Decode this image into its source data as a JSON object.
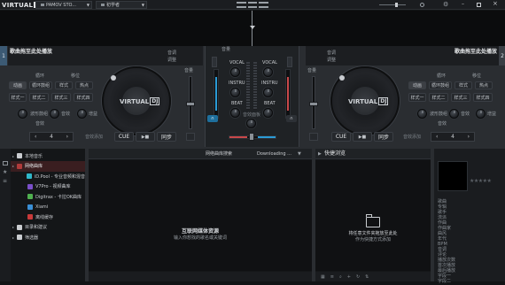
{
  "topbar": {
    "logo": "VIRTUAL",
    "logo_box": "DJ",
    "tab1": "PAMOV STO...",
    "tab2": "初学者"
  },
  "deck_left": {
    "title": "歌曲拖至此处播放",
    "sub1": "音调",
    "sub2": "调整",
    "section1": "循环",
    "section2": "移位",
    "pads_mode": "音效",
    "pad_tabs": [
      "动画",
      "循环鼓组",
      "样式",
      "热点"
    ],
    "pads": [
      "样式一",
      "样式二",
      "样式三",
      "样式四"
    ],
    "knob_labels": [
      "波形鼓组",
      "音效",
      "增益"
    ],
    "pitch_value": "4",
    "sync_label": "音效添加",
    "cue": "CUE",
    "play": "▶■",
    "sync": "同步",
    "turntable_logo": "VIRTUAL",
    "turntable_logo_box": "DJ"
  },
  "deck_right": {
    "title": "歌曲拖至此处播放",
    "sub1": "音调",
    "sub2": "调整",
    "section1": "循环",
    "section2": "移位",
    "pads_mode": "音效",
    "pad_tabs": [
      "动画",
      "循环鼓组",
      "样式",
      "热点"
    ],
    "pads": [
      "样式一",
      "样式二",
      "样式三",
      "样式四"
    ],
    "knob_labels": [
      "波形鼓组",
      "音效",
      "增益"
    ],
    "pitch_value": "4",
    "sync_label": "音效添加",
    "cue": "CUE",
    "play": "▶■",
    "sync": "同步",
    "turntable_logo": "VIRTUAL",
    "turntable_logo_box": "DJ"
  },
  "mixer": {
    "title": "音量",
    "vol_left": "音量",
    "vol_right": "音量",
    "rows": [
      "VOCAL",
      "VOCAL",
      "INSTRU",
      "INSTRU",
      "BEAT",
      "BEAT"
    ],
    "center_label": "音效面板"
  },
  "browser": {
    "tree": [
      {
        "label": "本地音乐",
        "indent": 0,
        "icon": "computer-icon"
      },
      {
        "label": "网络曲库",
        "indent": 0,
        "icon": "globe-icon",
        "selected": true
      },
      {
        "label": "iD.Pool - 专业音频和混音",
        "indent": 1,
        "icon": "idpool-icon"
      },
      {
        "label": "V7Pro - 视频曲库",
        "indent": 1,
        "icon": "video-icon"
      },
      {
        "label": "Digitrax - 卡拉OK曲库",
        "indent": 1,
        "icon": "karaoke-icon"
      },
      {
        "label": "Xiami",
        "indent": 1,
        "icon": "xiami-icon"
      },
      {
        "label": "离线缓存",
        "indent": 1,
        "icon": "cache-icon"
      },
      {
        "label": "目录和建议",
        "indent": 0,
        "icon": "list-icon"
      },
      {
        "label": "筛选器",
        "indent": 0,
        "icon": "filter-icon"
      }
    ],
    "search_label": "网络曲库搜索",
    "downloading": "Downloading ...",
    "empty_title": "互联网媒体资源",
    "empty_sub": "输入你想找的歌名或关键词",
    "quick_title": "快捷浏览",
    "quick_drop_title": "将任意文件夹拖放至此处",
    "quick_drop_sub": "作为快捷方式添加"
  },
  "info": {
    "fields": [
      "歌曲",
      "专辑",
      "歌手",
      "流派",
      "作曲",
      "作曲家",
      "曲风",
      "年代",
      "BPM",
      "音调",
      "评论",
      "播放次数",
      "首次播放",
      "最后播放",
      "字段一",
      "字段二"
    ]
  }
}
